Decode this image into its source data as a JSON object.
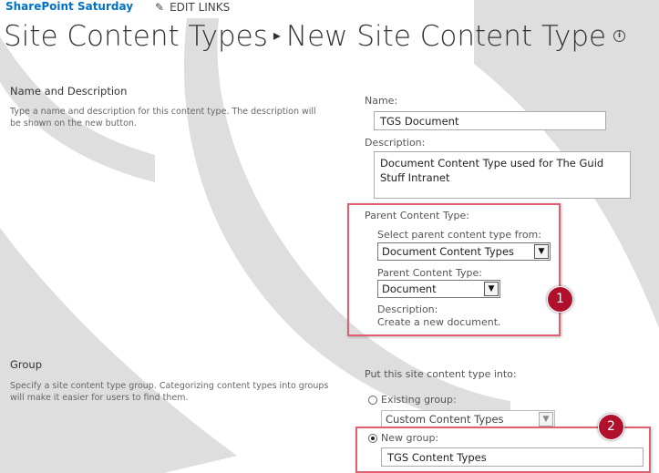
{
  "header": {
    "site_name": "SharePoint Saturday",
    "edit_links_label": "EDIT LINKS",
    "breadcrumb_root": "Site Content Types",
    "breadcrumb_separator": "▸",
    "page_title": "New Site Content Type",
    "info_glyph": "i"
  },
  "name_section": {
    "title": "Name and Description",
    "description": "Type a name and description for this content type. The description will be shown on the new button.",
    "name_label": "Name:",
    "name_value": "TGS Document",
    "description_label": "Description:",
    "description_value": "Document Content Type used for The Guid Stuff Intranet",
    "parent_section_label": "Parent Content Type:",
    "select_from_label": "Select parent content type from:",
    "select_from_value": "Document Content Types",
    "parent_type_label": "Parent Content Type:",
    "parent_type_value": "Document",
    "parent_desc_label": "Description:",
    "parent_desc_value": "Create a new document."
  },
  "group_section": {
    "title": "Group",
    "description": "Specify a site content type group. Categorizing content types into groups will make it easier for users to find them.",
    "put_into_label": "Put this site content type into:",
    "existing_group_label": "Existing group:",
    "existing_group_value": "Custom Content Types",
    "new_group_label": "New group:",
    "new_group_value": "TGS Content Types",
    "selected_option": "new"
  },
  "annotations": {
    "badge_1": "1",
    "badge_2": "2"
  },
  "icons": {
    "edit": "pencil-icon",
    "info": "info-icon",
    "dropdown": "chevron-down-icon"
  },
  "colors": {
    "link_blue": "#0072c6",
    "highlight_red": "#e06070",
    "badge_red": "#b0102b"
  }
}
